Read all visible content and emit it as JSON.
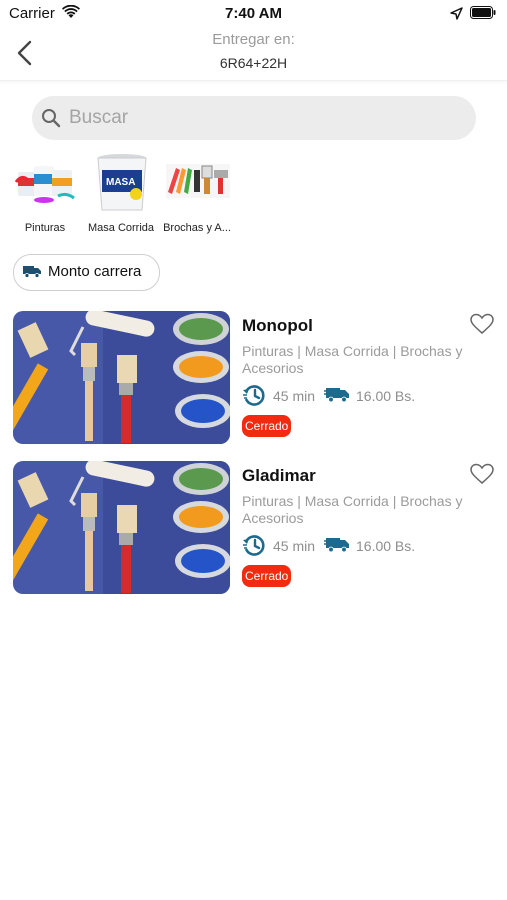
{
  "status_bar": {
    "carrier": "Carrier",
    "time": "7:40 AM"
  },
  "header": {
    "title": "Entregar en:",
    "address": "6R64+22H"
  },
  "search": {
    "placeholder": "Buscar"
  },
  "categories": [
    {
      "label": "Pinturas"
    },
    {
      "label": "Masa Corrida"
    },
    {
      "label": "Brochas y A..."
    }
  ],
  "filter_chip": {
    "label": "Monto carrera"
  },
  "stores": [
    {
      "name": "Monopol",
      "categories": "Pinturas | Masa Corrida | Brochas y Acesorios",
      "delivery_time": "45 min",
      "delivery_fee": "16.00 Bs.",
      "status": "Cerrado"
    },
    {
      "name": "Gladimar",
      "categories": "Pinturas | Masa Corrida | Brochas y Acesorios",
      "delivery_time": "45 min",
      "delivery_fee": "16.00 Bs.",
      "status": "Cerrado"
    }
  ],
  "colors": {
    "accent": "#1e6a8d",
    "closed_badge": "#f12a10",
    "search_bg": "#ececec"
  }
}
